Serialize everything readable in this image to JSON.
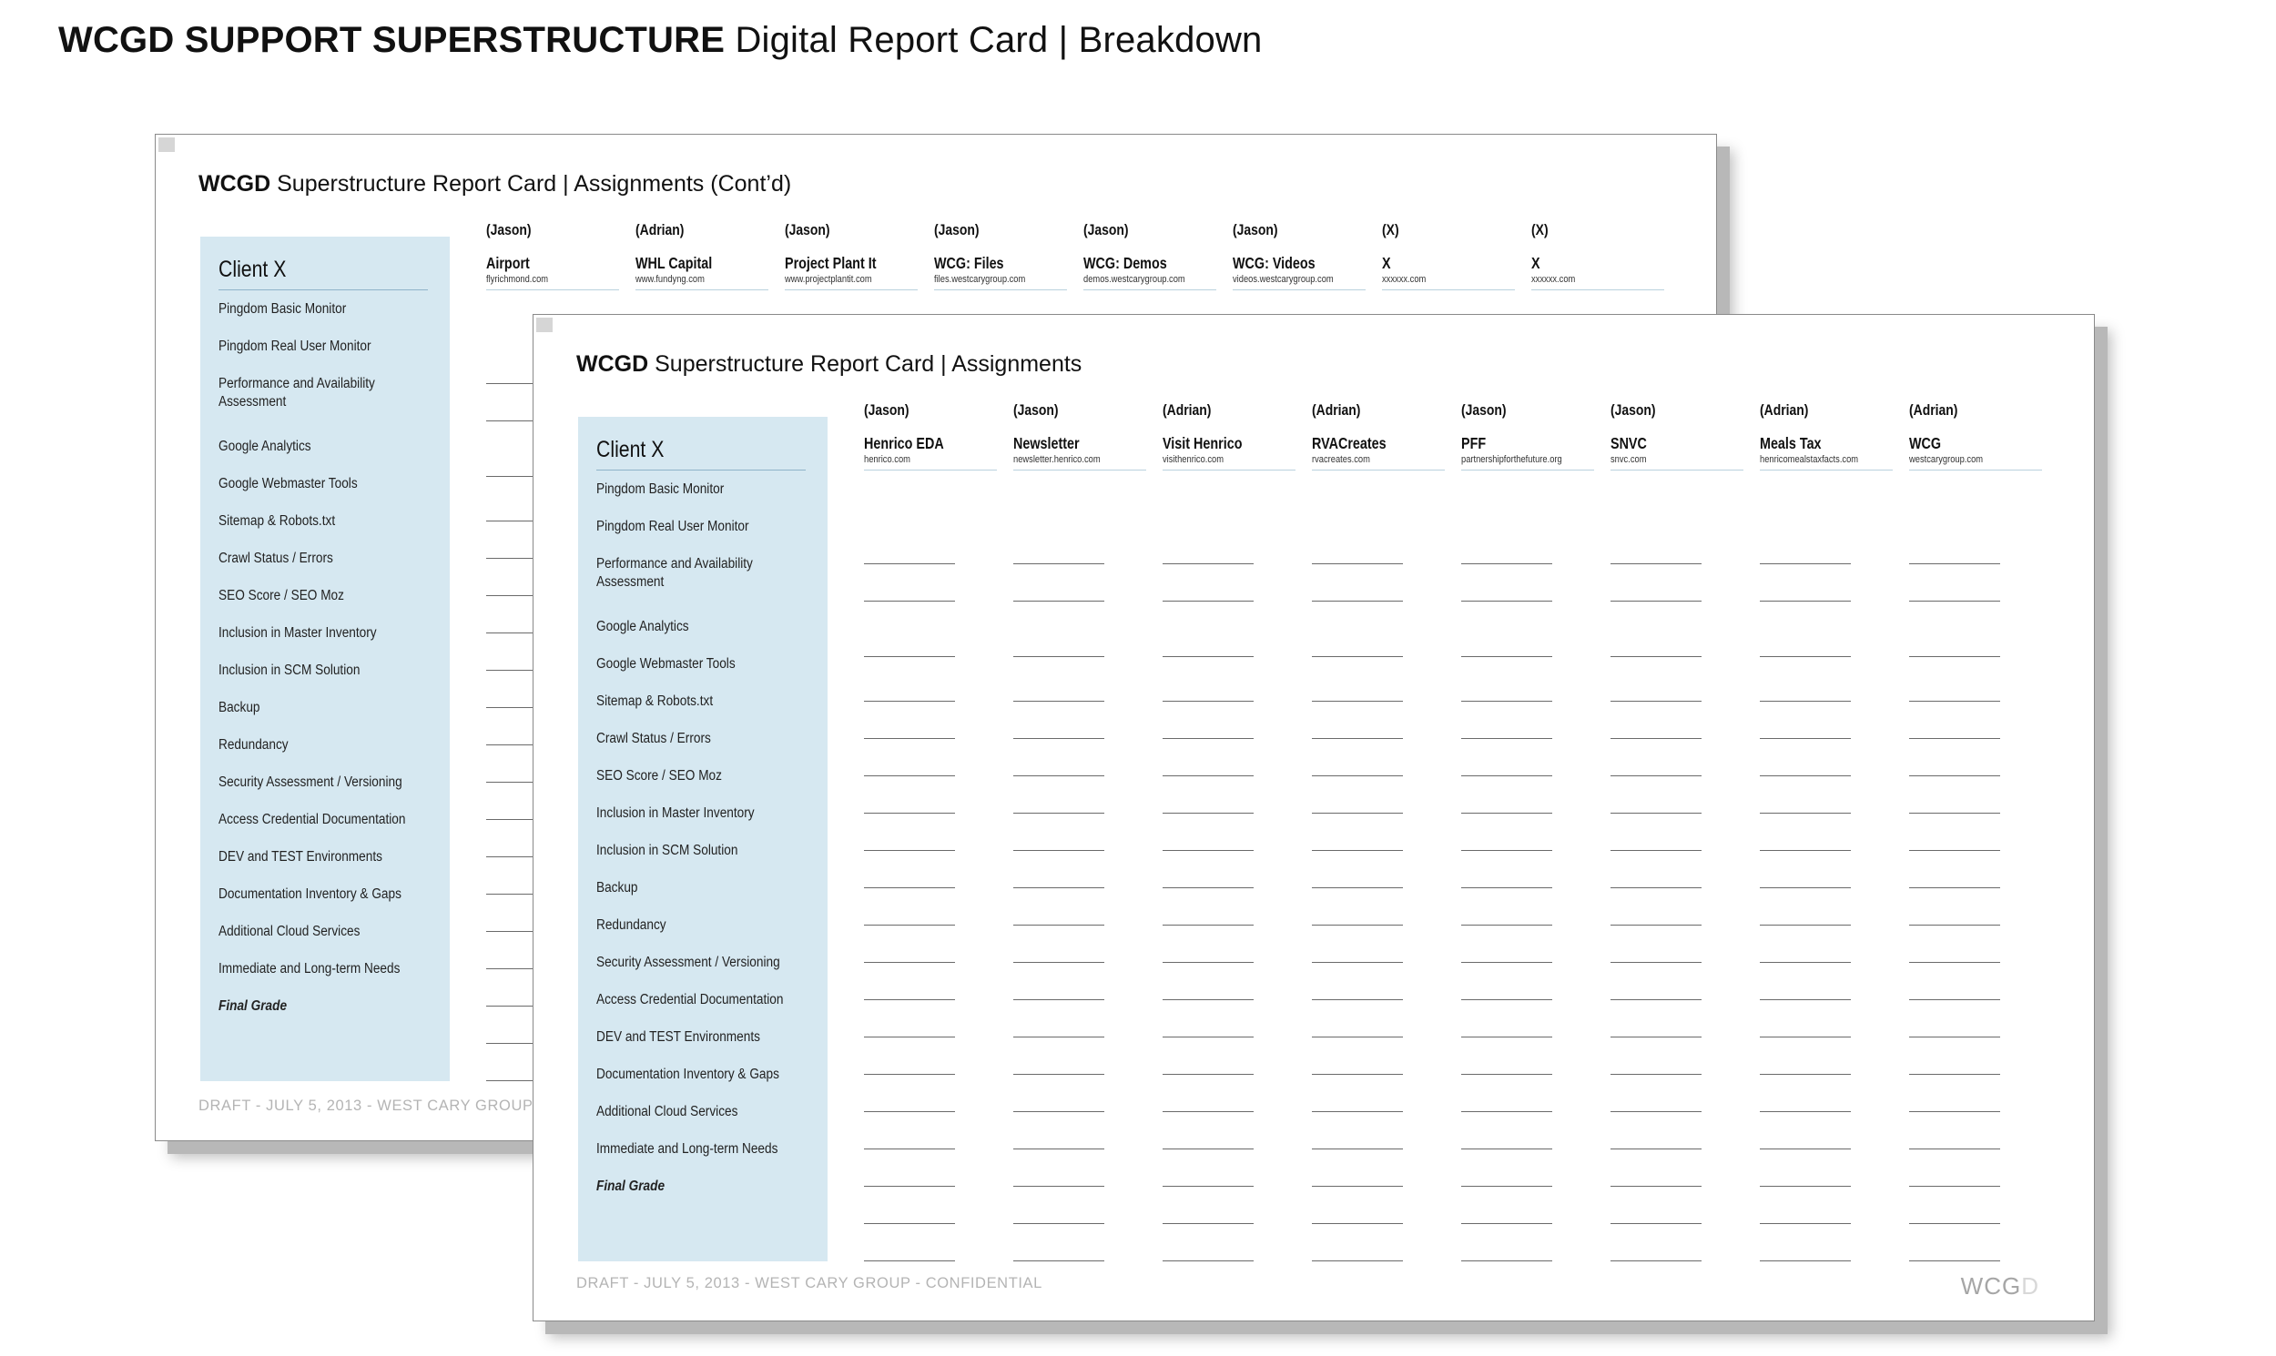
{
  "heading": {
    "bold": "WCGD SUPPORT SUPERSTRUCTURE",
    "rest": "Digital Report Card | Breakdown"
  },
  "criteria": [
    "Pingdom Basic Monitor",
    "Pingdom Real User Monitor",
    "Performance and Availability Assessment",
    "Google Analytics",
    "Google Webmaster Tools",
    "Sitemap & Robots.txt",
    "Crawl Status / Errors",
    "SEO Score / SEO Moz",
    "Inclusion in Master Inventory",
    "Inclusion in SCM Solution",
    "Backup",
    "Redundancy",
    "Security Assessment / Versioning",
    "Access Credential Documentation",
    "DEV and TEST Environments",
    "Documentation Inventory & Gaps",
    "Additional Cloud Services",
    "Immediate and Long-term Needs",
    "Final Grade"
  ],
  "back_slide": {
    "title_bold": "WCGD",
    "title_rest": "Superstructure Report Card | Assignments (Cont’d)",
    "client_label": "Client X",
    "columns": [
      {
        "person": "(Jason)",
        "site": "Airport",
        "url": "flyrichmond.com"
      },
      {
        "person": "(Adrian)",
        "site": "WHL Capital",
        "url": "www.fundyng.com"
      },
      {
        "person": "(Jason)",
        "site": "Project Plant It",
        "url": "www.projectplantit.com"
      },
      {
        "person": "(Jason)",
        "site": "WCG: Files",
        "url": "files.westcarygroup.com"
      },
      {
        "person": "(Jason)",
        "site": "WCG: Demos",
        "url": "demos.westcarygroup.com"
      },
      {
        "person": "(Jason)",
        "site": "WCG: Videos",
        "url": "videos.westcarygroup.com"
      },
      {
        "person": "(X)",
        "site": "X",
        "url": "xxxxxx.com"
      },
      {
        "person": "(X)",
        "site": "X",
        "url": "xxxxxx.com"
      }
    ],
    "footer": "DRAFT - JULY 5, 2013 - WEST CARY GROUP"
  },
  "front_slide": {
    "title_bold": "WCGD",
    "title_rest": "Superstructure Report Card | Assignments",
    "client_label": "Client X",
    "columns": [
      {
        "person": "(Jason)",
        "site": "Henrico EDA",
        "url": "henrico.com"
      },
      {
        "person": "(Jason)",
        "site": "Newsletter",
        "url": "newsletter.henrico.com"
      },
      {
        "person": "(Adrian)",
        "site": "Visit Henrico",
        "url": "visithenrico.com"
      },
      {
        "person": "(Adrian)",
        "site": "RVACreates",
        "url": "rvacreates.com"
      },
      {
        "person": "(Jason)",
        "site": "PFF",
        "url": "partnershipforthefuture.org"
      },
      {
        "person": "(Jason)",
        "site": "SNVC",
        "url": "snvc.com"
      },
      {
        "person": "(Adrian)",
        "site": "Meals Tax",
        "url": "henricomealstaxfacts.com"
      },
      {
        "person": "(Adrian)",
        "site": "WCG",
        "url": "westcarygroup.com"
      }
    ],
    "footer": "DRAFT - JULY 5, 2013 - WEST CARY GROUP - CONFIDENTIAL",
    "mark_main": "WCG",
    "mark_fade": "D"
  }
}
